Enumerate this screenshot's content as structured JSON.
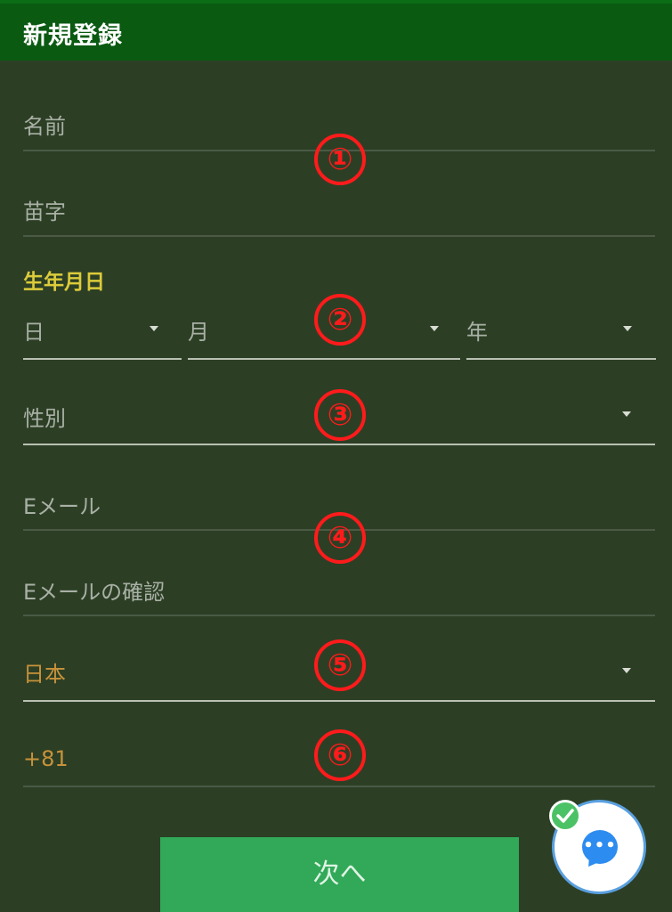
{
  "header": {
    "title": "新規登録"
  },
  "form": {
    "first_name_placeholder": "名前",
    "last_name_placeholder": "苗字",
    "birthday_label": "生年月日",
    "day_placeholder": "日",
    "month_placeholder": "月",
    "year_placeholder": "年",
    "gender_placeholder": "性別",
    "email_placeholder": "Eメール",
    "email_confirm_placeholder": "Eメールの確認",
    "country_value": "日本",
    "phone_prefix": "+81"
  },
  "markers": [
    "①",
    "②",
    "③",
    "④",
    "⑤",
    "⑥"
  ],
  "actions": {
    "next_label": "次へ"
  },
  "chat": {
    "dots": "•••"
  },
  "colors": {
    "header_bg": "#0a5a12",
    "page_bg": "#2c3f25",
    "accent_yellow": "#dccb3a",
    "accent_orange": "#c8923a",
    "marker_red": "#ff1b1b",
    "button_green": "#31a958"
  }
}
